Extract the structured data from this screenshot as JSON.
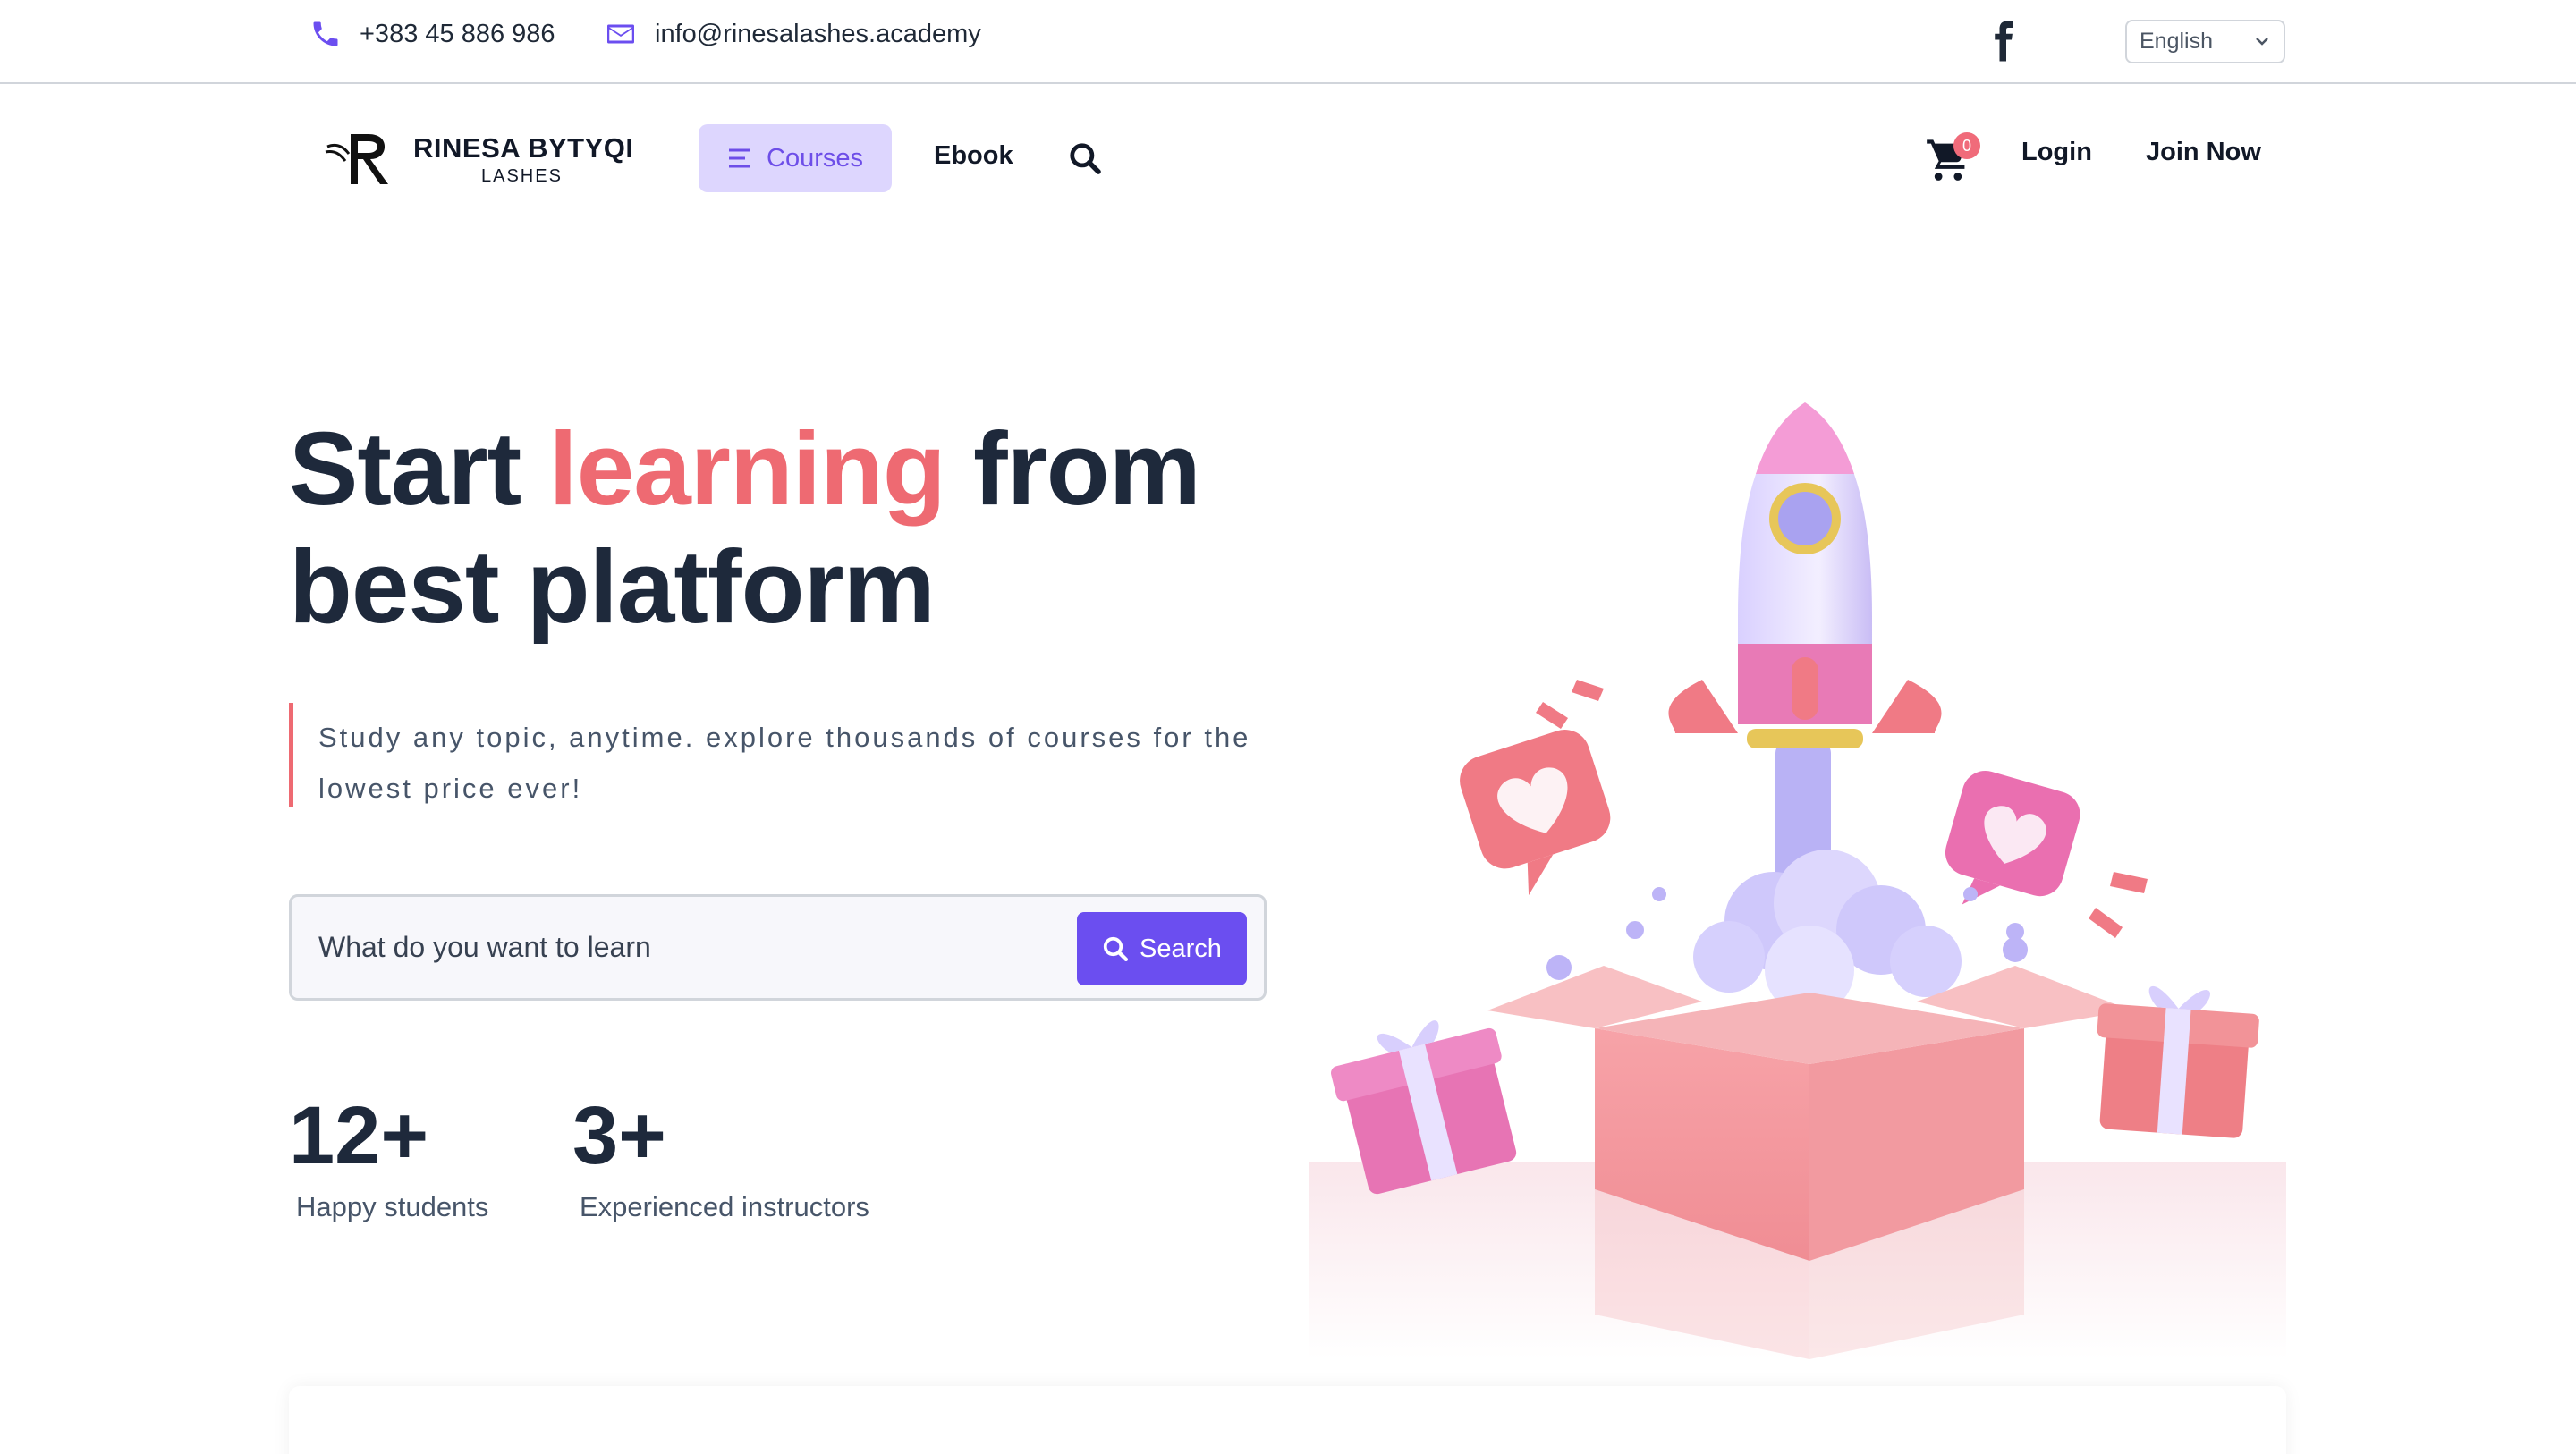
{
  "topbar": {
    "phone": "+383 45 886 986",
    "email": "info@rinesalashes.academy",
    "social_icon": "facebook-icon",
    "language": "English"
  },
  "nav": {
    "brand_name": "RINESA BYTYQI",
    "brand_sub": "LASHES",
    "courses": "Courses",
    "ebook": "Ebook",
    "cart_count": "0",
    "login": "Login",
    "join": "Join Now"
  },
  "hero": {
    "title_start": "Start ",
    "title_highlight": "learning",
    "title_end": " from best platform",
    "subtitle": "Study any topic, anytime. explore thousands of courses for the lowest price ever!",
    "search_placeholder": "What do you want to learn",
    "search_button": "Search"
  },
  "stats": [
    {
      "value": "12+",
      "label": "Happy students"
    },
    {
      "value": "3+",
      "label": "Experienced instructors"
    }
  ],
  "colors": {
    "accent": "#6b4ef0",
    "highlight": "#ee6a72",
    "nav_active_bg": "#ddd6fe",
    "heading": "#1e293b"
  }
}
